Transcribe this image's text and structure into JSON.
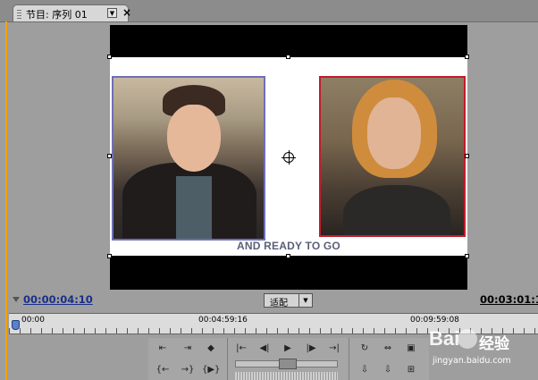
{
  "panel": {
    "tab_label": "节目: 序列 01",
    "dropdown_glyph": "▼",
    "close_glyph": "×"
  },
  "viewer": {
    "caption": "AND READY TO GO"
  },
  "timecode": {
    "current": "00:00:04:10",
    "duration": "00:03:01:1"
  },
  "fit_dropdown": {
    "label": "适配",
    "arrow": "▼"
  },
  "ruler": {
    "labels": [
      "00:00",
      "00:04:59:16",
      "00:09:59:08"
    ]
  },
  "controls": {
    "row1": [
      "⇤",
      "⇥",
      "◆",
      "|←",
      "◀|",
      "▶",
      "|▶",
      "→|",
      "↻",
      "⇔",
      "▣"
    ],
    "row2": [
      "{←",
      "→}",
      "{▶}",
      "⇩",
      "⇩",
      "⊞"
    ]
  },
  "watermark": {
    "logo": "Bai",
    "cn": "经验",
    "url": "jingyan.baidu.com"
  },
  "colors": {
    "accent_edge": "#f0a400",
    "timecode_blue": "#1a2f8a",
    "left_photo_border": "#6e6fb5",
    "right_photo_border": "#c01c2c"
  }
}
